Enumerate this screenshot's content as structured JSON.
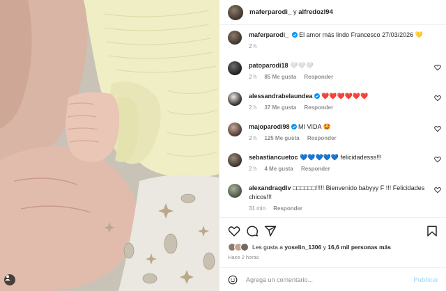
{
  "post": {
    "owner": "maferparodi_",
    "connector": "y",
    "collaborator": "alfredozl94"
  },
  "caption": {
    "user": "maferparodi_",
    "text": "El amor más lindo Francesco 27/03/2026 💛",
    "time": "2 h"
  },
  "comments": [
    {
      "user": "patoparodi18",
      "text": "🤍🤍🤍",
      "time": "2 h",
      "likes": "85 Me gusta",
      "reply": "Responder",
      "verified": false
    },
    {
      "user": "alessandrabelaundea",
      "text": "❤️❤️❤️❤️❤️❤️",
      "time": "2 h",
      "likes": "37 Me gusta",
      "reply": "Responder",
      "verified": true
    },
    {
      "user": "majoparodi98",
      "text": "MI VIDA 🤩",
      "time": "2 h",
      "likes": "125 Me gusta",
      "reply": "Responder",
      "verified": true
    },
    {
      "user": "sebastiancuetoc",
      "text": "💙💙💙💙💙 felicidadesss!!!",
      "time": "2 h",
      "likes": "4 Me gusta",
      "reply": "Responder",
      "verified": false
    },
    {
      "user": "alexandraqdlv",
      "text": "□□□□□□!!!!! Bienvenido babyyy F !!! Felicidades chicos!!!",
      "time": "31 min",
      "likes": "",
      "reply": "Responder",
      "verified": false
    }
  ],
  "likes": {
    "prefix": "Les gusta a",
    "user": "yoselin_1306",
    "middle": "y",
    "others": "16,6 mil personas más"
  },
  "posted_time": "Hace 2 horas",
  "add_comment": {
    "placeholder": "Agrega un comentario...",
    "publish": "Publicar"
  },
  "icons": {
    "like": "heart-icon",
    "comment": "comment-icon",
    "share": "share-icon",
    "save": "bookmark-icon",
    "emoji": "emoji-icon",
    "tag": "user-tag-icon"
  },
  "colors": {
    "verified": "#0095f6",
    "publish_disabled": "#b2dffc",
    "muted_text": "#8e8e8e"
  }
}
